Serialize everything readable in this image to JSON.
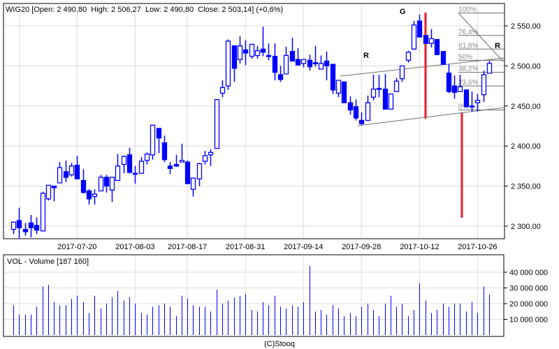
{
  "header": {
    "symbol": "WIG20",
    "text": "WIG20 [Open: 2 490,80  High: 2 506,27  Low: 2 490,80  Close: 2 503,14] (+0,6%)"
  },
  "volume_panel": {
    "title": "VOL - Volume [187 160]"
  },
  "footer": {
    "copyright": "(C)Stooq"
  },
  "colors": {
    "candle": "#0000ff",
    "grid": "#dcdcdc",
    "annotation_line": "#ee1c25",
    "fib": "#6e6e6e"
  },
  "chart_data": [
    {
      "type": "candlestick",
      "title": "WIG20",
      "ylim": [
        2280,
        2570
      ],
      "y_ticks": [
        "2 300,00",
        "2 350,00",
        "2 400,00",
        "2 450,00",
        "2 500,00",
        "2 550,00"
      ],
      "y_tick_values": [
        2300,
        2350,
        2400,
        2450,
        2500,
        2550
      ],
      "x_tick_labels": [
        "2017-07-20",
        "2017-08-03",
        "2017-08-17",
        "2017-08-31",
        "2017-09-14",
        "2017-09-28",
        "2017-10-12",
        "2017-10-26"
      ],
      "x_tick_index": [
        11,
        21,
        30,
        40,
        50,
        60,
        70,
        80
      ],
      "ohlc": [
        [
          2296,
          2305,
          2290,
          2305
        ],
        [
          2307,
          2323,
          2285,
          2298
        ],
        [
          2296,
          2304,
          2288,
          2293
        ],
        [
          2304,
          2314,
          2286,
          2298
        ],
        [
          2301,
          2311,
          2290,
          2295
        ],
        [
          2294,
          2343,
          2294,
          2341
        ],
        [
          2334,
          2351,
          2332,
          2351
        ],
        [
          2350,
          2350,
          2331,
          2348
        ],
        [
          2354,
          2380,
          2354,
          2373
        ],
        [
          2368,
          2382,
          2355,
          2361
        ],
        [
          2364,
          2379,
          2362,
          2375
        ],
        [
          2376,
          2388,
          2359,
          2359
        ],
        [
          2357,
          2371,
          2341,
          2342
        ],
        [
          2344,
          2346,
          2327,
          2334
        ],
        [
          2337,
          2346,
          2327,
          2340
        ],
        [
          2344,
          2364,
          2344,
          2361
        ],
        [
          2361,
          2364,
          2342,
          2350
        ],
        [
          2345,
          2361,
          2330,
          2361
        ],
        [
          2357,
          2390,
          2357,
          2375
        ],
        [
          2377,
          2388,
          2366,
          2387
        ],
        [
          2389,
          2398,
          2366,
          2367
        ],
        [
          2366,
          2375,
          2353,
          2366
        ],
        [
          2366,
          2386,
          2366,
          2381
        ],
        [
          2382,
          2392,
          2377,
          2390
        ],
        [
          2389,
          2426,
          2383,
          2426
        ],
        [
          2422,
          2422,
          2391,
          2410
        ],
        [
          2404,
          2413,
          2380,
          2383
        ],
        [
          2375,
          2380,
          2365,
          2372
        ],
        [
          2377,
          2389,
          2374,
          2375
        ],
        [
          2380,
          2403,
          2380,
          2382
        ],
        [
          2380,
          2382,
          2353,
          2353
        ],
        [
          2346,
          2360,
          2337,
          2360
        ],
        [
          2359,
          2379,
          2350,
          2378
        ],
        [
          2381,
          2394,
          2377,
          2388
        ],
        [
          2389,
          2396,
          2375,
          2392
        ],
        [
          2397,
          2458,
          2397,
          2458
        ],
        [
          2466,
          2482,
          2461,
          2473
        ],
        [
          2475,
          2533,
          2470,
          2531
        ],
        [
          2525,
          2525,
          2480,
          2497
        ],
        [
          2508,
          2537,
          2503,
          2525
        ],
        [
          2520,
          2532,
          2501,
          2516
        ],
        [
          2512,
          2527,
          2509,
          2527
        ],
        [
          2513,
          2525,
          2509,
          2519
        ],
        [
          2521,
          2549,
          2512,
          2517
        ],
        [
          2513,
          2528,
          2507,
          2512
        ],
        [
          2512,
          2528,
          2482,
          2492
        ],
        [
          2489,
          2500,
          2480,
          2483
        ],
        [
          2490,
          2524,
          2490,
          2513
        ],
        [
          2518,
          2535,
          2506,
          2506
        ],
        [
          2508,
          2522,
          2501,
          2501
        ],
        [
          2503,
          2508,
          2498,
          2508
        ],
        [
          2507,
          2514,
          2494,
          2499
        ],
        [
          2504,
          2525,
          2499,
          2503
        ],
        [
          2496,
          2513,
          2496,
          2503
        ],
        [
          2506,
          2518,
          2482,
          2500
        ],
        [
          2502,
          2502,
          2465,
          2470
        ],
        [
          2466,
          2482,
          2461,
          2482
        ],
        [
          2480,
          2480,
          2454,
          2454
        ],
        [
          2454,
          2462,
          2439,
          2445
        ],
        [
          2449,
          2458,
          2432,
          2435
        ],
        [
          2432,
          2442,
          2426,
          2428
        ],
        [
          2432,
          2463,
          2432,
          2454
        ],
        [
          2461,
          2489,
          2457,
          2471
        ],
        [
          2472,
          2489,
          2461,
          2471
        ],
        [
          2471,
          2490,
          2446,
          2446
        ],
        [
          2446,
          2465,
          2446,
          2465
        ],
        [
          2468,
          2485,
          2468,
          2481
        ],
        [
          2484,
          2500,
          2480,
          2500
        ],
        [
          2507,
          2519,
          2504,
          2517
        ],
        [
          2521,
          2556,
          2520,
          2551
        ],
        [
          2556,
          2564,
          2536,
          2536
        ],
        [
          2538,
          2538,
          2528,
          2528
        ],
        [
          2528,
          2546,
          2523,
          2534
        ],
        [
          2533,
          2533,
          2514,
          2514
        ],
        [
          2518,
          2518,
          2502,
          2502
        ],
        [
          2491,
          2502,
          2466,
          2468
        ],
        [
          2475,
          2488,
          2459,
          2467
        ],
        [
          2468,
          2489,
          2468,
          2474
        ],
        [
          2470,
          2470,
          2449,
          2449
        ],
        [
          2450,
          2468,
          2443,
          2449
        ],
        [
          2454,
          2465,
          2443,
          2457
        ],
        [
          2464,
          2494,
          2455,
          2489
        ],
        [
          2490.8,
          2506.27,
          2490.8,
          2503.14
        ]
      ],
      "fibonacci": {
        "levels": [
          "100%",
          "76,4%",
          "61,8%",
          "50%",
          "38,2%",
          "23,6%",
          "0%"
        ],
        "prices": [
          2566,
          2538,
          2521,
          2507,
          2492,
          2475,
          2445
        ]
      },
      "annotations": [
        "G",
        "R",
        "R"
      ]
    },
    {
      "type": "bar",
      "title": "VOL - Volume [187 160]",
      "ylim": [
        0,
        50000000
      ],
      "y_ticks": [
        "10 000 000",
        "20 000 000",
        "30 000 000",
        "40 000 000"
      ],
      "y_tick_values": [
        10000000,
        20000000,
        30000000,
        40000000
      ],
      "values_millions": [
        19,
        13,
        13,
        13,
        18,
        31,
        32,
        21,
        19,
        19,
        23,
        25,
        21,
        14,
        25,
        17,
        20,
        24,
        28,
        22,
        24,
        20,
        14,
        13,
        18,
        19,
        20,
        18,
        12,
        25,
        23,
        19,
        18,
        18,
        15,
        29,
        20,
        22,
        24,
        25,
        26,
        16,
        15,
        21,
        19,
        25,
        18,
        17,
        19,
        18,
        21,
        44,
        15,
        16,
        13,
        19,
        17,
        12,
        14,
        12,
        18,
        20,
        16,
        12,
        20,
        25,
        18,
        20,
        12,
        16,
        33,
        22,
        14,
        16,
        20,
        18,
        20,
        20,
        15,
        21,
        14,
        31,
        26
      ]
    }
  ]
}
